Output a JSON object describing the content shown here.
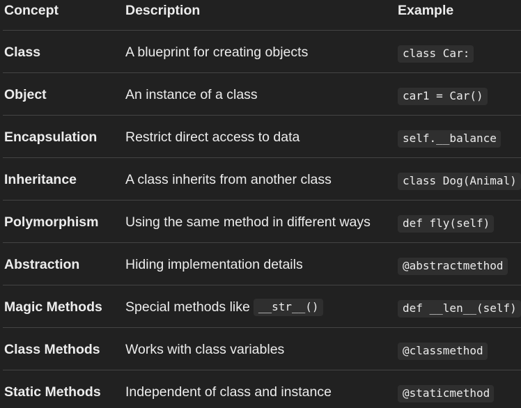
{
  "headers": {
    "concept": "Concept",
    "description": "Description",
    "example": "Example"
  },
  "rows": [
    {
      "concept": "Class",
      "description": "A blueprint for creating objects",
      "example": "class Car:"
    },
    {
      "concept": "Object",
      "description": "An instance of a class",
      "example": "car1 = Car()"
    },
    {
      "concept": "Encapsulation",
      "description": "Restrict direct access to data",
      "example": "self.__balance"
    },
    {
      "concept": "Inheritance",
      "description": "A class inherits from another class",
      "example": "class Dog(Animal)"
    },
    {
      "concept": "Polymorphism",
      "description": "Using the same method in different ways",
      "example": "def fly(self)"
    },
    {
      "concept": "Abstraction",
      "description": "Hiding implementation details",
      "example": "@abstractmethod"
    },
    {
      "concept": "Magic Methods",
      "description": "Special methods like",
      "description_code": "__str__()",
      "example": "def __len__(self)"
    },
    {
      "concept": "Class Methods",
      "description": "Works with class variables",
      "example": "@classmethod"
    },
    {
      "concept": "Static Methods",
      "description": "Independent of class and instance",
      "example": "@staticmethod"
    }
  ]
}
